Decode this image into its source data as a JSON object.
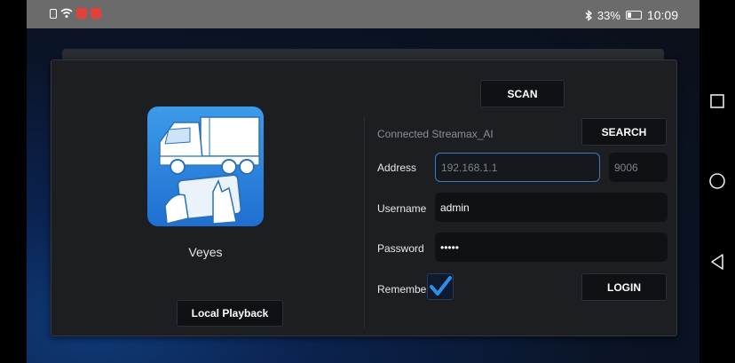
{
  "statusbar": {
    "battery_text": "33%",
    "time": "10:09",
    "icons": [
      "sim-icon",
      "wifi-icon",
      "notification-icon",
      "notification-icon",
      "bluetooth-icon",
      "battery-icon"
    ]
  },
  "navbar": {
    "icons": [
      "square-recent-icon",
      "circle-home-icon",
      "triangle-back-icon"
    ]
  },
  "app": {
    "name": "Veyes",
    "icon": "truck-tablet-icon",
    "local_playback_label": "Local Playback"
  },
  "form": {
    "scan_label": "SCAN",
    "search_label": "SEARCH",
    "connected_text": "Connected Streamax_AI",
    "address_label": "Address",
    "address_placeholder": "192.168.1.1",
    "port_placeholder": "9006",
    "username_label": "Username",
    "username_value": "admin",
    "password_label": "Password",
    "password_value": "•••••",
    "remember_label": "Remember",
    "remember_checked": true,
    "login_label": "LOGIN"
  },
  "colors": {
    "accent": "#1f6fd0",
    "check": "#2f8ee8",
    "dialog_bg": "#1c1e22"
  }
}
